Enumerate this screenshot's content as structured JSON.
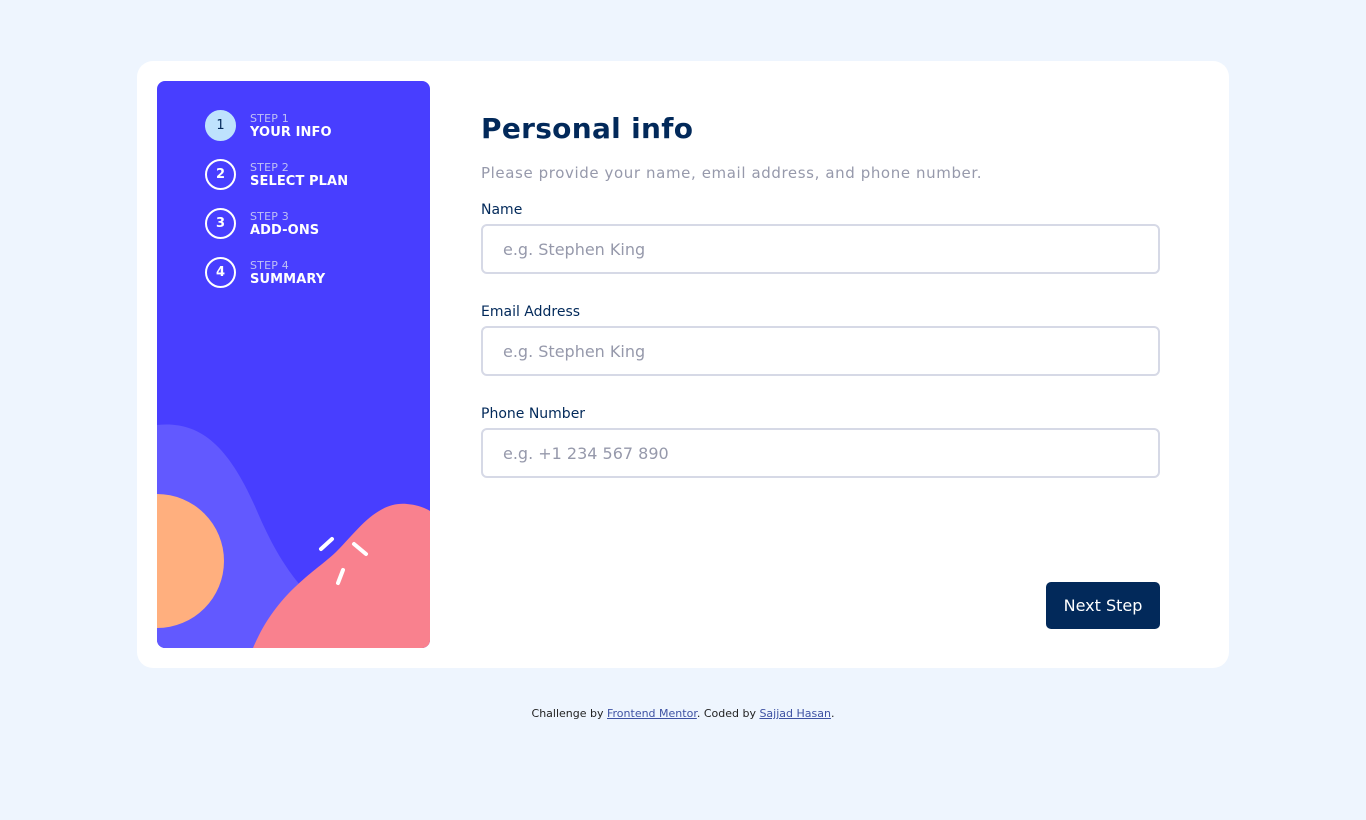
{
  "sidebar": {
    "steps": [
      {
        "number": "1",
        "label": "STEP 1",
        "title": "YOUR INFO",
        "active": true
      },
      {
        "number": "2",
        "label": "STEP 2",
        "title": "SELECT PLAN",
        "active": false
      },
      {
        "number": "3",
        "label": "STEP 3",
        "title": "ADD-ONS",
        "active": false
      },
      {
        "number": "4",
        "label": "STEP 4",
        "title": "SUMMARY",
        "active": false
      }
    ]
  },
  "main": {
    "title": "Personal info",
    "subtitle": "Please provide your name, email address, and phone number.",
    "fields": [
      {
        "label": "Name",
        "placeholder": "e.g. Stephen King",
        "value": ""
      },
      {
        "label": "Email Address",
        "placeholder": "e.g. Stephen King",
        "value": ""
      },
      {
        "label": "Phone Number",
        "placeholder": "e.g. +1 234 567 890",
        "value": ""
      }
    ],
    "next_button": "Next Step"
  },
  "footer": {
    "prefix": "Challenge by ",
    "link1": "Frontend Mentor",
    "middle": ". Coded by ",
    "link2": "Sajjad Hasan",
    "suffix": "."
  },
  "colors": {
    "sidebar_bg": "#483eff",
    "active_step_bg": "#bee2fd",
    "primary_text": "#02295a",
    "muted_text": "#9699ab",
    "border": "#d6d9e6",
    "page_bg": "#eef5fe",
    "shape_light_purple": "#6259ff",
    "shape_orange": "#ffaf7e",
    "shape_pink": "#f9818e"
  }
}
